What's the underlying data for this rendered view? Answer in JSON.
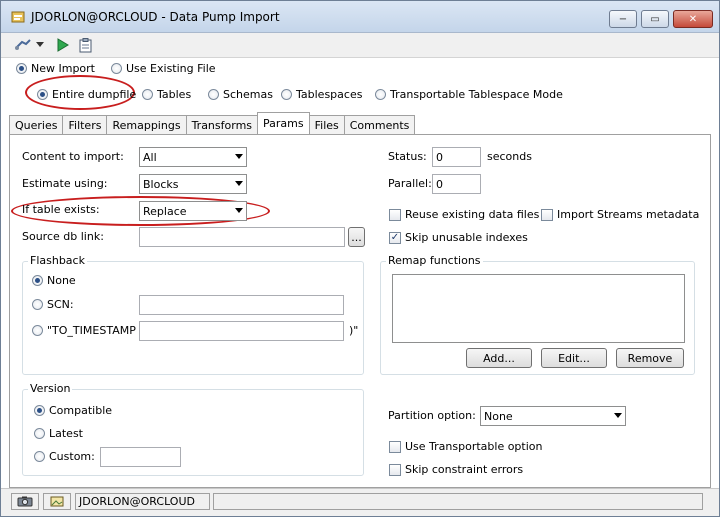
{
  "window": {
    "title": "JDORLON@ORCLOUD - Data Pump Import",
    "buttons": {
      "minimize": "−",
      "maximize": "▭",
      "close": "✕"
    }
  },
  "toolbar": {
    "icons": [
      "connection-icon",
      "dropdown-arrow-icon",
      "run-icon",
      "clipboard-icon"
    ]
  },
  "source_mode": {
    "options": [
      "New Import",
      "Use Existing File"
    ],
    "selected": "New Import"
  },
  "import_type": {
    "options": [
      "Entire dumpfile",
      "Tables",
      "Schemas",
      "Tablespaces",
      "Transportable Tablespace Mode"
    ],
    "selected": "Entire dumpfile"
  },
  "tabs": [
    "Queries",
    "Filters",
    "Remappings",
    "Transforms",
    "Params",
    "Files",
    "Comments"
  ],
  "active_tab": "Params",
  "params": {
    "content_to_import": {
      "label": "Content to import:",
      "value": "All"
    },
    "estimate_using": {
      "label": "Estimate using:",
      "value": "Blocks"
    },
    "if_table_exists": {
      "label": "If table exists:",
      "value": "Replace"
    },
    "source_db_link": {
      "label": "Source db link:",
      "value": "",
      "browse": "..."
    },
    "status": {
      "label": "Status:",
      "value": "0",
      "unit": "seconds"
    },
    "parallel": {
      "label": "Parallel:",
      "value": "0"
    },
    "reuse_datafiles": {
      "label": "Reuse existing data files",
      "checked": false
    },
    "import_streams": {
      "label": "Import Streams metadata",
      "checked": false
    },
    "skip_unusable": {
      "label": "Skip unusable indexes",
      "checked": true
    }
  },
  "flashback": {
    "title": "Flashback",
    "options": {
      "none": "None",
      "scn": "SCN:",
      "timestamp": "\"TO_TIMESTAMP (",
      "timestamp_close": ")\""
    },
    "selected": "None",
    "scn_value": "",
    "timestamp_value": ""
  },
  "remap": {
    "title": "Remap functions",
    "buttons": {
      "add": "Add...",
      "edit": "Edit...",
      "remove": "Remove"
    }
  },
  "version": {
    "title": "Version",
    "options": {
      "compatible": "Compatible",
      "latest": "Latest",
      "custom": "Custom:"
    },
    "selected": "Compatible",
    "custom_value": ""
  },
  "partition": {
    "label": "Partition option:",
    "value": "None",
    "use_transportable": {
      "label": "Use Transportable option",
      "checked": false
    },
    "skip_constraint": {
      "label": "Skip constraint errors",
      "checked": false
    }
  },
  "statusbar": {
    "connection": "JDORLON@ORCLOUD",
    "icons": [
      "camera-icon",
      "image-icon"
    ]
  },
  "colors": {
    "annotation": "#c81e1e",
    "title_bar": "#c4d5ea"
  }
}
